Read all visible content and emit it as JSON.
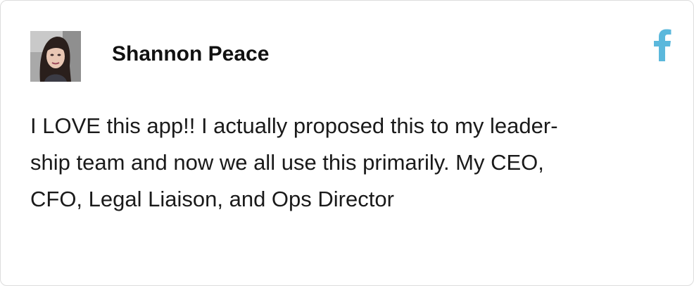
{
  "review": {
    "author_name": "Shannon Peace",
    "text": "I LOVE this app!! I actually proposed this to my leader-ship team and now we all use this primarily. My CEO, CFO, Legal Liaison, and Ops Director",
    "text_lines": [
      "I LOVE this app!! I actually proposed this to my leader-",
      "ship team and now we all use this primarily. My CEO,",
      "CFO, Legal Liaison, and Ops Director"
    ],
    "avatar_icon": "user-photo",
    "source_icon": "facebook-icon"
  },
  "colors": {
    "facebook_accent": "#5bb8dc",
    "border": "#dcdcdc",
    "text": "#1a1a1a"
  }
}
